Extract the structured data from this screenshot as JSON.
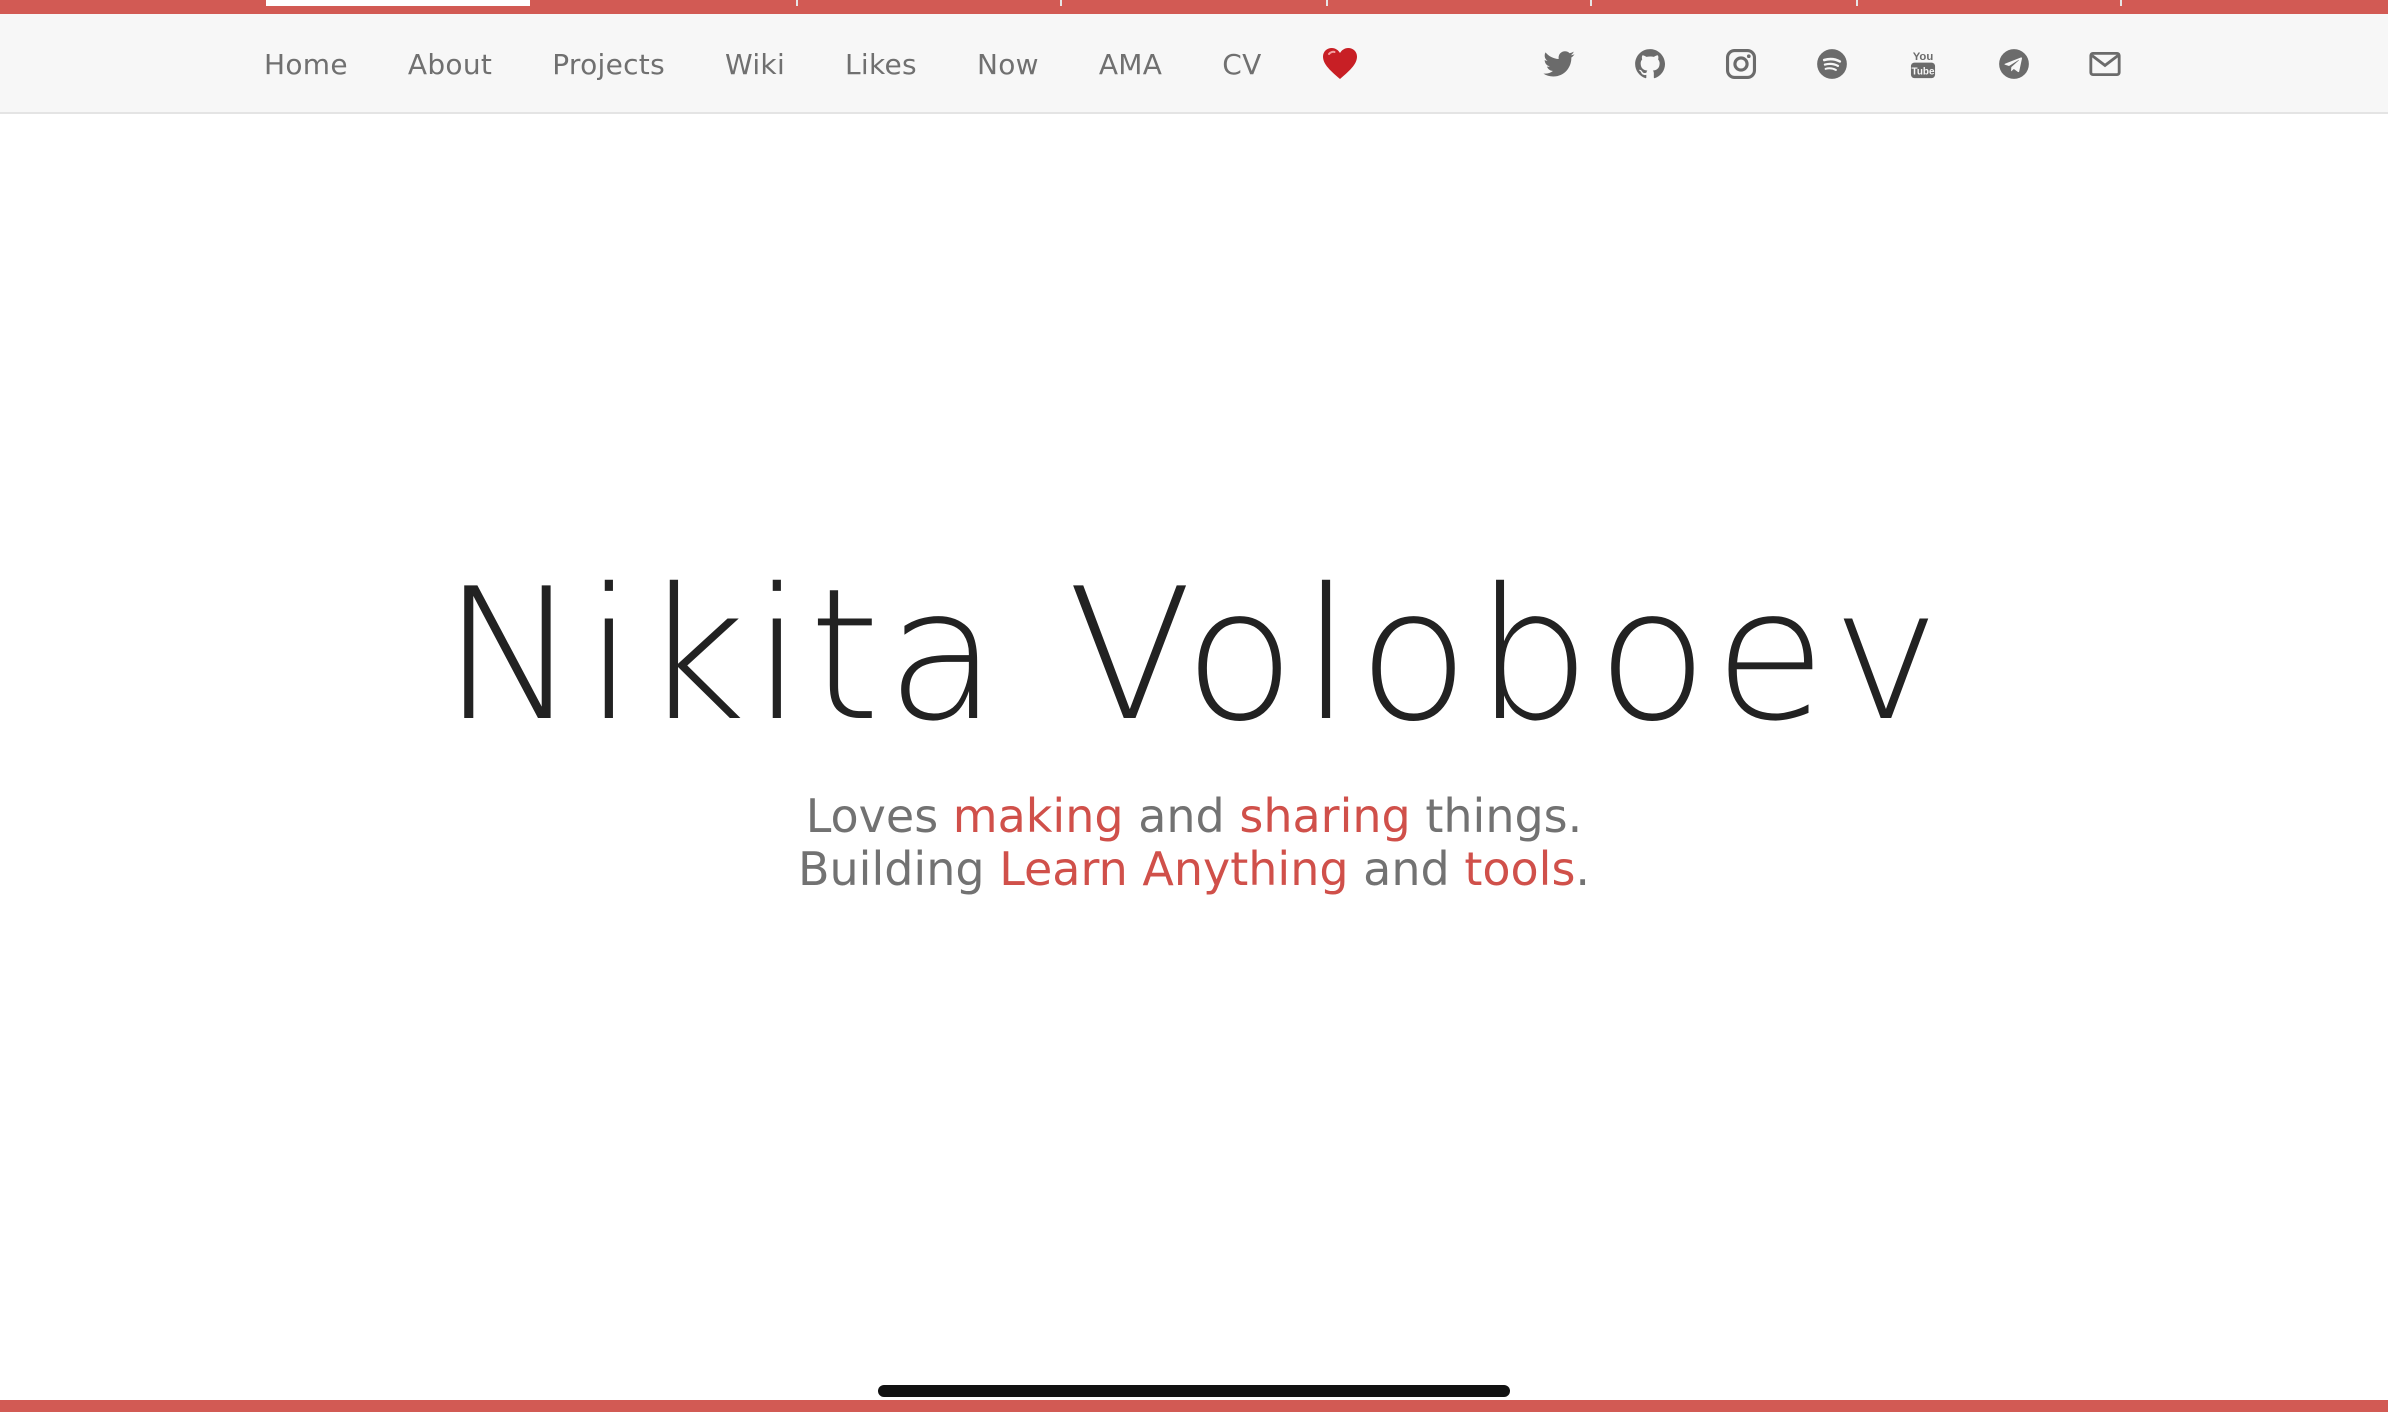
{
  "nav": {
    "links": [
      "Home",
      "About",
      "Projects",
      "Wiki",
      "Likes",
      "Now",
      "AMA",
      "CV"
    ],
    "heart_icon": "heart-icon"
  },
  "social": {
    "icons": [
      "twitter-icon",
      "github-icon",
      "instagram-icon",
      "spotify-icon",
      "youtube-icon",
      "telegram-icon",
      "mail-icon"
    ]
  },
  "hero": {
    "title": "Nikita Voloboev",
    "line1": {
      "part1": "Loves ",
      "link1": "making",
      "part2": " and ",
      "link2": "sharing",
      "part3": " things."
    },
    "line2": {
      "part1": "Building ",
      "link1": "Learn Anything",
      "part2": " and ",
      "link2": "tools",
      "part3": "."
    }
  },
  "colors": {
    "accent": "#d0504a",
    "bar": "#d25a54",
    "title": "#222222",
    "nav_text": "#707070",
    "icon": "#6b6b6b"
  }
}
